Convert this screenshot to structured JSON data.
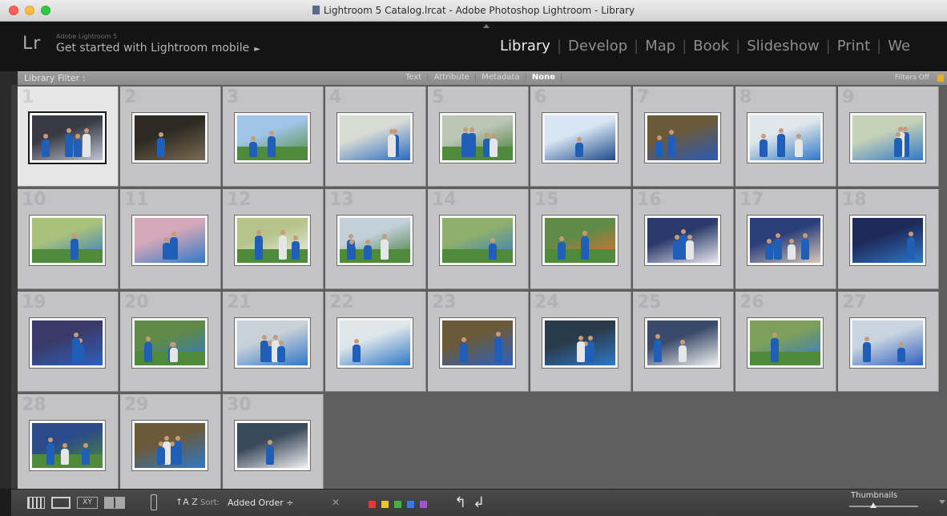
{
  "window": {
    "title": "Lightroom 5 Catalog.lrcat - Adobe Photoshop Lightroom - Library"
  },
  "identity": {
    "logo": "Lr",
    "product": "Adobe Lightroom 5",
    "mobile_text": "Get started with Lightroom mobile",
    "mobile_arrow": "►"
  },
  "modules": [
    {
      "label": "Library",
      "active": true
    },
    {
      "label": "Develop",
      "active": false
    },
    {
      "label": "Map",
      "active": false
    },
    {
      "label": "Book",
      "active": false
    },
    {
      "label": "Slideshow",
      "active": false
    },
    {
      "label": "Print",
      "active": false
    },
    {
      "label": "We",
      "active": false
    }
  ],
  "filter_bar": {
    "title": "Library Filter :",
    "options": [
      {
        "label": "Text",
        "selected": false
      },
      {
        "label": "Attribute",
        "selected": false
      },
      {
        "label": "Metadata",
        "selected": false
      },
      {
        "label": "None",
        "selected": true
      }
    ],
    "status": "Filters Off"
  },
  "grid": {
    "selected_index": 1,
    "photos": [
      {
        "num": "1",
        "scene": "team huddle indoors",
        "palette": [
          "#3a3a44",
          "#c0c6d4"
        ]
      },
      {
        "num": "2",
        "scene": "broadcast booth",
        "palette": [
          "#2c2a22",
          "#7c6a52"
        ]
      },
      {
        "num": "3",
        "scene": "empty stadium field",
        "palette": [
          "#9fc4e6",
          "#4f8a3a"
        ]
      },
      {
        "num": "4",
        "scene": "player portrait",
        "palette": [
          "#d8dcd4",
          "#2a6ac2"
        ]
      },
      {
        "num": "5",
        "scene": "groundsman watering pitch",
        "palette": [
          "#bcc6b6",
          "#3f7a32"
        ]
      },
      {
        "num": "6",
        "scene": "locker room",
        "palette": [
          "#d8e6f4",
          "#1e4a8a"
        ]
      },
      {
        "num": "7",
        "scene": "match action",
        "palette": [
          "#6b5a3a",
          "#2a5ab8"
        ]
      },
      {
        "num": "8",
        "scene": "players in training",
        "palette": [
          "#dfe6ea",
          "#2f78c8"
        ]
      },
      {
        "num": "9",
        "scene": "training pair",
        "palette": [
          "#c6d2b8",
          "#2f78c8"
        ]
      },
      {
        "num": "10",
        "scene": "group chat on pitch",
        "palette": [
          "#a8c27c",
          "#2f78c8"
        ]
      },
      {
        "num": "11",
        "scene": "players in bibs",
        "palette": [
          "#d4a8b8",
          "#2f78c8"
        ]
      },
      {
        "num": "12",
        "scene": "stretching drill",
        "palette": [
          "#b6c48c",
          "#f0f0f0"
        ]
      },
      {
        "num": "13",
        "scene": "training jog",
        "palette": [
          "#c2d0d8",
          "#3f7a32"
        ]
      },
      {
        "num": "14",
        "scene": "squad on pitch",
        "palette": [
          "#8eb06c",
          "#2f78c8"
        ]
      },
      {
        "num": "15",
        "scene": "training cones",
        "palette": [
          "#5f8a48",
          "#e87030"
        ]
      },
      {
        "num": "16",
        "scene": "dressing room",
        "palette": [
          "#2a3a6a",
          "#e8e8ee"
        ]
      },
      {
        "num": "17",
        "scene": "crowd in stands",
        "palette": [
          "#2a3e7a",
          "#d8c8b8"
        ]
      },
      {
        "num": "18",
        "scene": "player close-up",
        "palette": [
          "#1e2a5a",
          "#2f78c8"
        ]
      },
      {
        "num": "19",
        "scene": "team celebration",
        "palette": [
          "#3a3a6a",
          "#2f60c0"
        ]
      },
      {
        "num": "20",
        "scene": "match play",
        "palette": [
          "#5f8a48",
          "#2f78c8"
        ]
      },
      {
        "num": "21",
        "scene": "substitutes bench",
        "palette": [
          "#c8d0d8",
          "#2f78c8"
        ]
      },
      {
        "num": "22",
        "scene": "player with bag",
        "palette": [
          "#dfe6ea",
          "#2f78c8"
        ]
      },
      {
        "num": "23",
        "scene": "tackle in match",
        "palette": [
          "#6a5a3a",
          "#2f60c0"
        ]
      },
      {
        "num": "24",
        "scene": "injury treatment",
        "palette": [
          "#2a3a4a",
          "#2f78c8"
        ]
      },
      {
        "num": "25",
        "scene": "referee with players",
        "palette": [
          "#3a4a6a",
          "#f0f0f0"
        ]
      },
      {
        "num": "26",
        "scene": "wide match view",
        "palette": [
          "#7ca05a",
          "#2f78c8"
        ]
      },
      {
        "num": "27",
        "scene": "goal celebration",
        "palette": [
          "#c8d4e0",
          "#2f60c0"
        ]
      },
      {
        "num": "28",
        "scene": "team photo",
        "palette": [
          "#2a4a8a",
          "#4f8a3a"
        ]
      },
      {
        "num": "29",
        "scene": "player dribbling",
        "palette": [
          "#6a5a3a",
          "#2f78c8"
        ]
      },
      {
        "num": "30",
        "scene": "advertising boards match",
        "palette": [
          "#3a4a5a",
          "#f0f0f0"
        ]
      }
    ]
  },
  "toolbar": {
    "sort_direction": "↑A Z",
    "sort_label": "Sort:",
    "sort_value": "Added Order ÷",
    "reject": "✕",
    "color_labels": [
      "#e03c3c",
      "#e8c43a",
      "#48b048",
      "#3a7ae0",
      "#9a58c8"
    ],
    "rotate_left": "↰",
    "rotate_right": "↲",
    "thumbnails_label": "Thumbnails",
    "thumbnail_size": 0.35
  }
}
